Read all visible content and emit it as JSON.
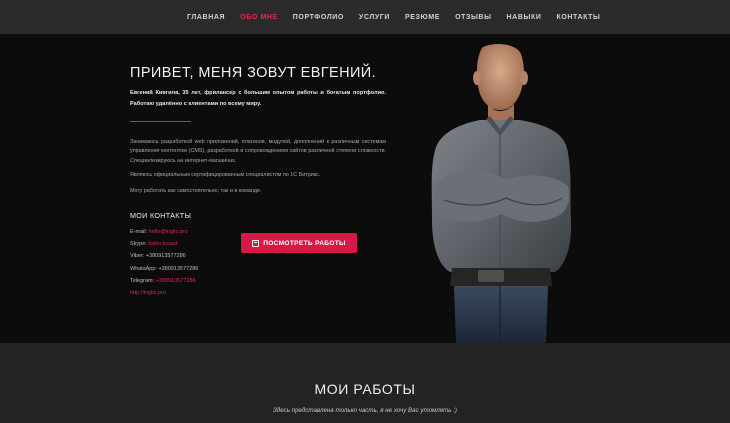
{
  "nav": {
    "items": [
      {
        "label": "ГЛАВНАЯ"
      },
      {
        "label": "ОБО МНЕ"
      },
      {
        "label": "ПОРТФОЛИО"
      },
      {
        "label": "УСЛУГИ"
      },
      {
        "label": "РЕЗЮМЕ"
      },
      {
        "label": "ОТЗЫВЫ"
      },
      {
        "label": "НАВЫКИ"
      },
      {
        "label": "КОНТАКТЫ"
      }
    ],
    "active_index": 1,
    "accent_color": "#e0264d"
  },
  "hero": {
    "title": "ПРИВЕТ, МЕНЯ ЗОВУТ ЕВГЕНИЙ.",
    "intro": "Евгений Кивгила, 35 лет, фрилансер с большим опытом работы и богатым портфолио. Работаю удалённо с клиентами по всему миру.",
    "paragraphs": [
      "Занимаюсь разработкой web приложений, плагинов, модулей, дополнений к различным системам управления контентом (CMS), разработкой и сопровождением сайтов различной степени сложности. Специализируюсь на интернет-магазинах.",
      "Являюсь официальным сертифицированным специалистом по 1С Битрикс.",
      "Могу работать как самостоятельно, так и в команде."
    ],
    "contacts_heading": "МОИ КОНТАКТЫ",
    "contacts": {
      "email_label": "E-mail:",
      "email_value": "hello@inglis.pro",
      "skype_label": "Skype:",
      "skype_value": "kalko.kovad",
      "viber_label": "Viber:",
      "viber_value": "+380913577286",
      "whatsapp_label": "WhatsApp:",
      "whatsapp_value": "+380913577286",
      "telegram_label": "Telegram:",
      "telegram_value": "+380913577286",
      "site": "http://inglis.pro"
    },
    "button_label": "ПОСМОТРЕТЬ РАБОТЫ",
    "button_color": "#d51a47"
  },
  "works": {
    "title": "МОИ РАБОТЫ",
    "subtitle": "Здесь представлена только часть, я не хочу Вас утомлять :)"
  }
}
